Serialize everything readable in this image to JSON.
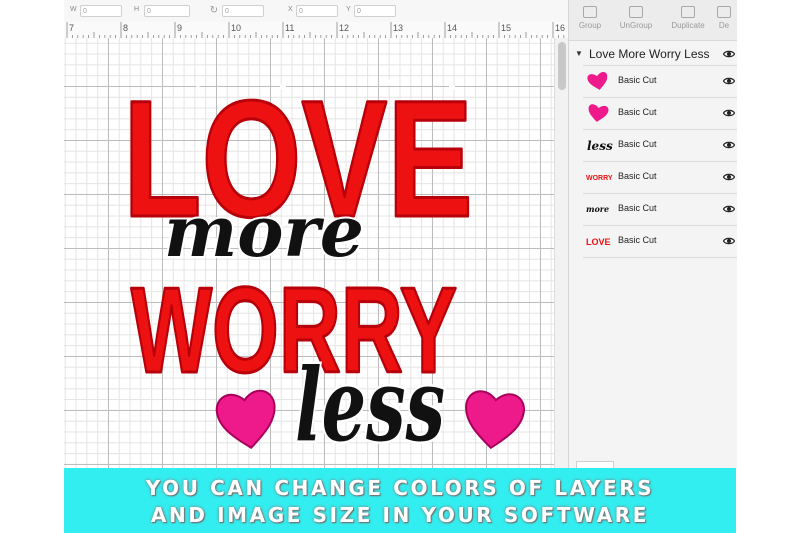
{
  "toolbar": {
    "w_label": "W",
    "w_value": "0",
    "h_label": "H",
    "h_value": "0",
    "rotate_value": "0",
    "x_label": "X",
    "x_value": "0",
    "y_label": "Y",
    "y_value": "0"
  },
  "ruler": {
    "ticks": [
      "7",
      "8",
      "9",
      "10",
      "11",
      "12",
      "13",
      "14",
      "15",
      "16"
    ]
  },
  "design": {
    "word_love": "LOVE",
    "word_more": "more",
    "word_worry": "WORRY",
    "word_less": "less"
  },
  "layers_panel": {
    "actions": [
      {
        "label": "Group",
        "icon": "group-icon"
      },
      {
        "label": "UnGroup",
        "icon": "ungroup-icon"
      },
      {
        "label": "Duplicate",
        "icon": "duplicate-icon"
      },
      {
        "label": "De",
        "icon": "delete-icon"
      }
    ],
    "group_title": "Love More Worry Less",
    "layers": [
      {
        "thumb": "heart",
        "thumb_text": "",
        "name": "Basic Cut"
      },
      {
        "thumb": "heart",
        "thumb_text": "",
        "name": "Basic Cut"
      },
      {
        "thumb": "text",
        "thumb_text": "less",
        "name": "Basic Cut"
      },
      {
        "thumb": "text",
        "thumb_text": "WORRY",
        "name": "Basic Cut"
      },
      {
        "thumb": "text",
        "thumb_text": "more",
        "name": "Basic Cut"
      },
      {
        "thumb": "text",
        "thumb_text": "LOVE",
        "name": "Basic Cut"
      }
    ]
  },
  "banner": {
    "line1": "YOU CAN CHANGE COLORS OF LAYERS",
    "line2": "AND IMAGE SIZE IN YOUR SOFTWARE"
  },
  "colors": {
    "red": "#ee1111",
    "red_outline": "#b8000a",
    "pink": "#ee1a8c",
    "black": "#111111",
    "banner_bg": "#33eef0"
  }
}
